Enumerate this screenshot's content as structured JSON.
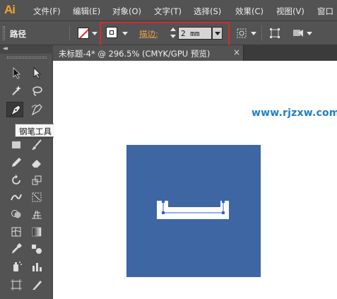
{
  "app": {
    "logo": "Ai"
  },
  "menubar": {
    "items": [
      "文件(F)",
      "编辑(E)",
      "对象(O)",
      "文字(T)",
      "选择(S)",
      "效果(C)",
      "视图(V)",
      "窗口"
    ]
  },
  "controlbar": {
    "selection_label": "路径",
    "stroke_label": "描边",
    "stroke_colon": ":",
    "stroke_value": "2 mm",
    "highlight_color": "#e0262a"
  },
  "document_tab": {
    "label": "未标题-4* @ 296.5% (CMYK/GPU 预览)",
    "close_glyph": "×"
  },
  "tooltip": {
    "text": "钢笔工具 (P)"
  },
  "canvas": {
    "watermark": "www.rjzxw.com",
    "artboard_color": "#3d66a3"
  },
  "tools_panel": {
    "collapse_glyph": "◂◂",
    "tools": [
      "selection-tool",
      "direct-selection-tool",
      "magic-wand-tool",
      "lasso-tool",
      "pen-tool",
      "curvature-tool",
      "type-tool",
      "line-segment-tool",
      "rectangle-tool",
      "paintbrush-tool",
      "pencil-tool",
      "eraser-tool",
      "rotate-tool",
      "scale-tool",
      "width-tool",
      "free-transform-tool",
      "shape-builder-tool",
      "perspective-grid-tool",
      "mesh-tool",
      "gradient-tool",
      "eyedropper-tool",
      "blend-tool",
      "symbol-sprayer-tool",
      "column-graph-tool",
      "artboard-tool",
      "slice-tool",
      "hand-tool",
      "zoom-tool"
    ]
  }
}
